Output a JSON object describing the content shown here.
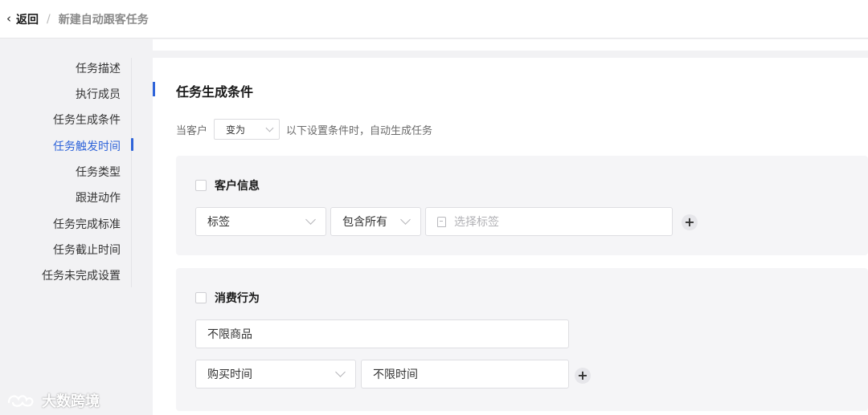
{
  "header": {
    "back_label": "返回",
    "separator": "/",
    "current": "新建自动跟客任务"
  },
  "nav": {
    "items": [
      {
        "label": "任务描述"
      },
      {
        "label": "执行成员"
      },
      {
        "label": "任务生成条件"
      },
      {
        "label": "任务触发时间"
      },
      {
        "label": "任务类型"
      },
      {
        "label": "跟进动作"
      },
      {
        "label": "任务完成标准"
      },
      {
        "label": "任务截止时间"
      },
      {
        "label": "任务未完成设置"
      }
    ],
    "active_label": "任务触发时间"
  },
  "section": {
    "title": "任务生成条件",
    "condition_prefix": "当客户",
    "condition_select": "变为",
    "condition_suffix": "以下设置条件时，自动生成任务"
  },
  "customer_info": {
    "title": "客户信息",
    "field_select": "标签",
    "operator_select": "包含所有",
    "tag_placeholder": "选择标签"
  },
  "purchase_behavior": {
    "title": "消费行为",
    "product_field": "不限商品",
    "time_select": "购买时间",
    "time_value": "不限时间"
  },
  "watermark": {
    "text": "大数跨境"
  },
  "colors": {
    "accent": "#2f64d9",
    "group_bg": "#f5f5f7",
    "page_bg": "#f2f2f4"
  }
}
